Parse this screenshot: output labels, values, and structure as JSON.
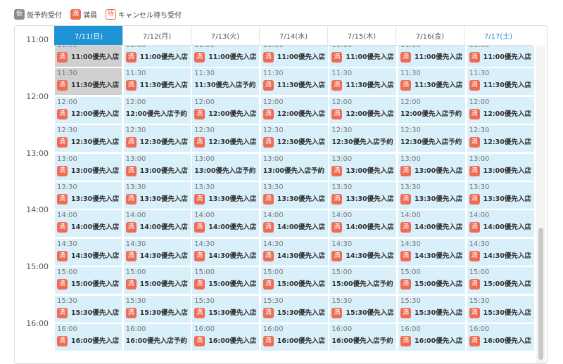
{
  "legend": [
    {
      "badge": "仮",
      "label": "仮予約受付",
      "style": "gray"
    },
    {
      "badge": "満",
      "label": "満員",
      "style": "full"
    },
    {
      "badge": "待",
      "label": "キャンセル待ち受付",
      "style": "wait"
    }
  ],
  "days": [
    "7/11(日)",
    "7/12(月)",
    "7/13(火)",
    "7/14(水)",
    "7/15(木)",
    "7/16(金)",
    "7/17(土)"
  ],
  "hours": [
    "11:00",
    "12:00",
    "13:00",
    "14:00",
    "15:00",
    "16:00"
  ],
  "slot_times": [
    "11:00",
    "11:30",
    "12:00",
    "12:30",
    "13:00",
    "13:30",
    "14:00",
    "14:30",
    "15:00",
    "15:30",
    "16:00"
  ],
  "full_badge": "満",
  "full_suffix": "優先入店",
  "open_suffix": "優先入店予約",
  "full_matrix": [
    [
      1,
      1,
      1,
      1,
      1,
      1,
      1
    ],
    [
      1,
      1,
      0,
      1,
      1,
      1,
      1
    ],
    [
      1,
      0,
      1,
      1,
      1,
      0,
      1
    ],
    [
      1,
      1,
      1,
      1,
      0,
      0,
      1
    ],
    [
      1,
      1,
      0,
      0,
      1,
      1,
      1
    ],
    [
      1,
      1,
      1,
      1,
      1,
      1,
      1
    ],
    [
      1,
      1,
      1,
      1,
      1,
      1,
      1
    ],
    [
      1,
      1,
      1,
      1,
      1,
      1,
      1
    ],
    [
      1,
      1,
      1,
      1,
      0,
      1,
      1
    ],
    [
      1,
      1,
      1,
      1,
      1,
      1,
      1
    ],
    [
      1,
      0,
      1,
      1,
      0,
      1,
      1
    ]
  ],
  "past_matrix": [
    [
      1,
      0,
      0,
      0,
      0,
      0,
      0
    ],
    [
      1,
      0,
      0,
      0,
      0,
      0,
      0
    ]
  ],
  "scrollbar_position": 0.6,
  "colors": {
    "accent": "#1e93d6",
    "full": "#ef6b54",
    "cell": "#d9f0fa",
    "past": "#d0d0d0"
  }
}
